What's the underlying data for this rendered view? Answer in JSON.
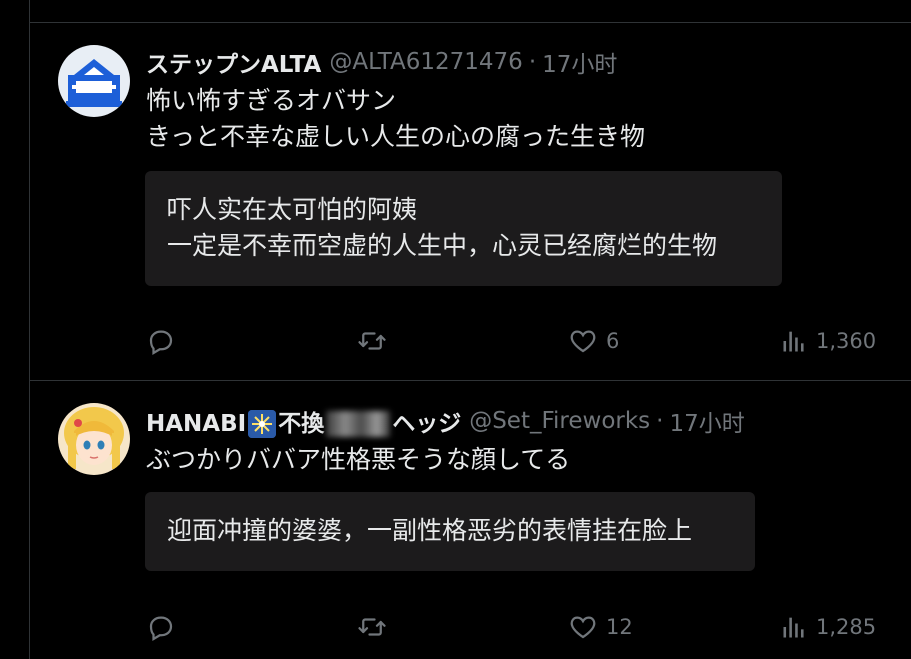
{
  "tweets": [
    {
      "display_name": "ステップンALTA",
      "handle": "@ALTA61271476",
      "time": "17小时",
      "text_lines": [
        "怖い怖すぎるオバサン",
        "きっと不幸な虚しい人生の心の腐った生き物"
      ],
      "translation_lines": [
        "吓人实在太可怕的阿姨",
        "一定是不幸而空虚的人生中，心灵已经腐烂的生物"
      ],
      "reply_count": "",
      "retweet_count": "",
      "like_count": "6",
      "view_count": "1,360"
    },
    {
      "display_name_prefix": "HANABI",
      "display_name_mid": "不換",
      "display_name_suffix": "ヘッジ",
      "handle": "@Set_Fireworks",
      "time": "17小时",
      "text_lines": [
        "ぶつかりババア性格悪そうな顔してる"
      ],
      "translation_lines": [
        "迎面冲撞的婆婆，一副性格恶劣的表情挂在脸上"
      ],
      "reply_count": "",
      "retweet_count": "",
      "like_count": "12",
      "view_count": "1,285"
    }
  ],
  "icons": {
    "reply": "reply-icon",
    "retweet": "retweet-icon",
    "like": "heart-icon",
    "views": "views-icon",
    "firework": "firework-emoji"
  },
  "colors": {
    "background": "#000000",
    "text": "#e7e9ea",
    "muted": "#71767b",
    "divider": "#2f3336",
    "translation_bg": "#1c1b1c"
  }
}
